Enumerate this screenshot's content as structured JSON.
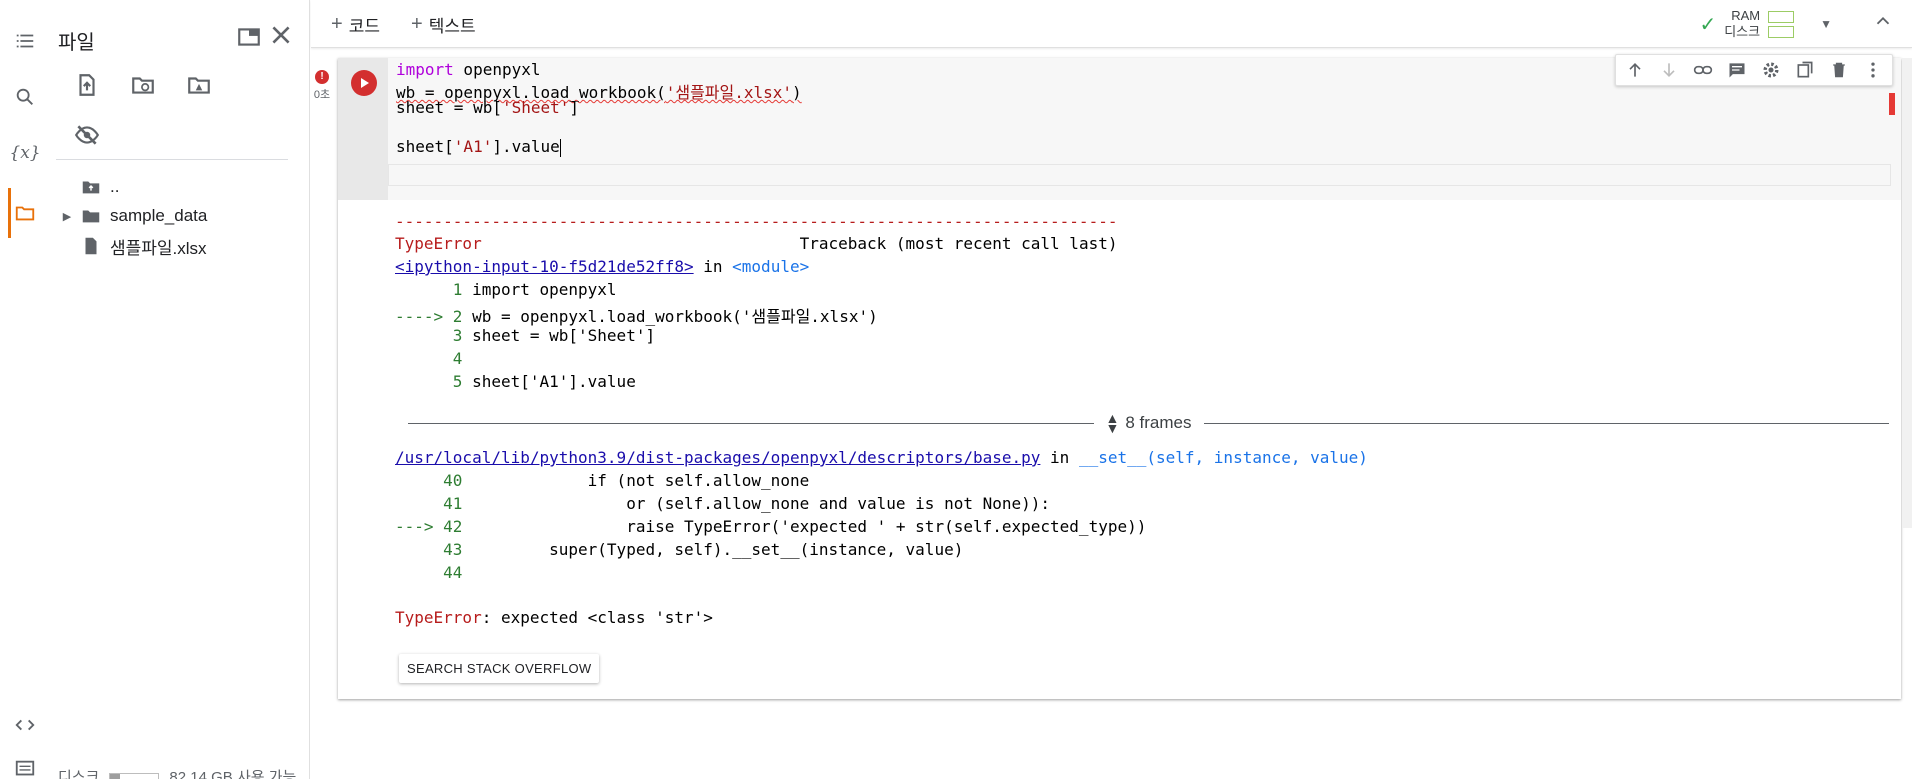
{
  "file_panel": {
    "title": "파일",
    "tree": [
      {
        "label": ".."
      },
      {
        "label": "sample_data"
      },
      {
        "label": "샘플파일.xlsx"
      }
    ],
    "disk_label": "디스크",
    "disk_free": "82.14 GB 사용 가능"
  },
  "toolbar": {
    "add_code": "코드",
    "add_text": "텍스트",
    "ram_label": "RAM",
    "disk_label": "디스크"
  },
  "cell": {
    "exec_time": "0초",
    "code": {
      "line1_kw": "import",
      "line1_rest": " openpyxl",
      "line2_pre": "wb = openpyxl.load_workbook(",
      "line2_str": "'샘플파일.xlsx'",
      "line2_post": ")",
      "line3_pre": "sheet = wb[",
      "line3_str": "'Sheet'",
      "line3_post": "]",
      "line5_pre": "sheet[",
      "line5_str": "'A1'",
      "line5_post": "].value"
    },
    "output": {
      "dashes": "---------------------------------------------------------------------------",
      "error_type": "TypeError",
      "traceback_header": "                                 Traceback (most recent call last)",
      "input_link": "<ipython-input-10-f5d21de52ff8>",
      "in_word": " in ",
      "module": "<module>",
      "src": [
        {
          "prefix": "      1 ",
          "code": "import openpyxl"
        },
        {
          "prefix": "----> 2 ",
          "code": "wb = openpyxl.load_workbook('샘플파일.xlsx')"
        },
        {
          "prefix": "      3 ",
          "code": "sheet = wb['Sheet']"
        },
        {
          "prefix": "      4 ",
          "code": ""
        },
        {
          "prefix": "      5 ",
          "code": "sheet['A1'].value"
        }
      ],
      "frames_label": "8 frames",
      "lib_path": "/usr/local/lib/python3.9/dist-packages/openpyxl/descriptors/base.py",
      "lib_in": " in ",
      "lib_func": "__set__(self, instance, value)",
      "lib_src": [
        {
          "prefix": "     40 ",
          "code": "            if (not self.allow_none"
        },
        {
          "prefix": "     41 ",
          "code": "                or (self.allow_none and value is not None)):"
        },
        {
          "prefix": "---> 42 ",
          "code": "                raise TypeError('expected ' + str(self.expected_type))"
        },
        {
          "prefix": "     43 ",
          "code": "        super(Typed, self).__set__(instance, value)"
        },
        {
          "prefix": "     44 ",
          "code": ""
        }
      ],
      "final_error_type": "TypeError",
      "final_error_msg": ": expected <class 'str'>",
      "so_button": "SEARCH STACK OVERFLOW"
    }
  },
  "colors": {
    "accent": "#e8710a",
    "error": "#d32f2f",
    "ok": "#34a853"
  }
}
